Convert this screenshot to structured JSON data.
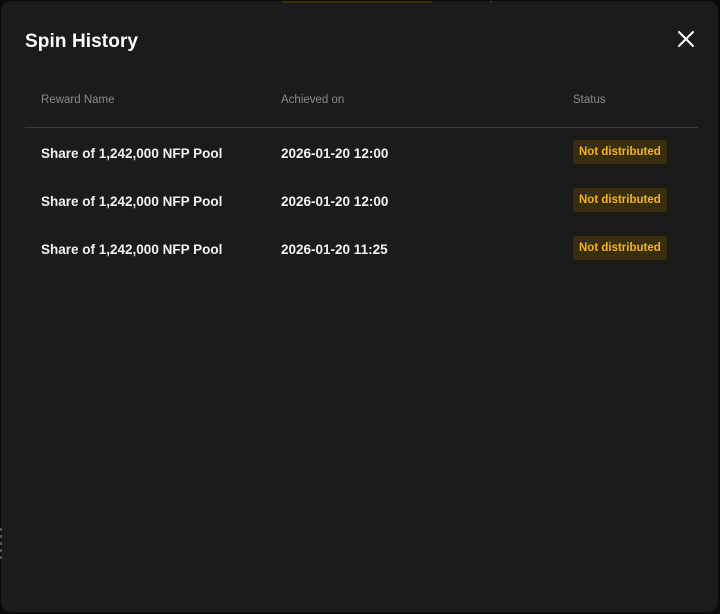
{
  "modal": {
    "title": "Spin History",
    "close_icon": "close-icon"
  },
  "table": {
    "headers": {
      "reward": "Reward Name",
      "date": "Achieved on",
      "status": "Status"
    },
    "rows": [
      {
        "reward": "Share of 1,242,000 NFP Pool",
        "date": "2026-01-20 12:00",
        "status": "Not distributed"
      },
      {
        "reward": "Share of 1,242,000 NFP Pool",
        "date": "2026-01-20 12:00",
        "status": "Not distributed"
      },
      {
        "reward": "Share of 1,242,000 NFP Pool",
        "date": "2026-01-20 11:25",
        "status": "Not distributed"
      }
    ]
  },
  "colors": {
    "background": "#1b1b1b",
    "badge_bg": "#3a2d0e",
    "badge_text": "#f2b21c"
  }
}
